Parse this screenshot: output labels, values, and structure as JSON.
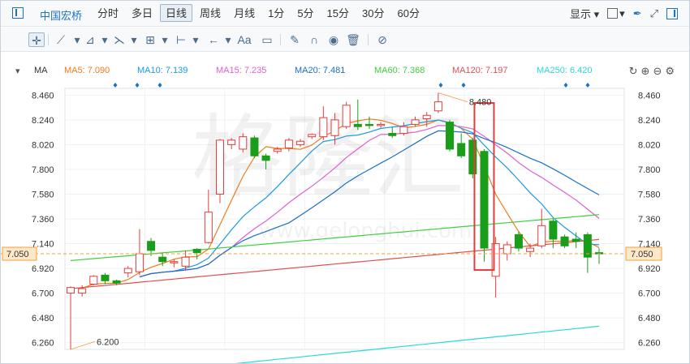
{
  "toolbar": {
    "ticker": "中国宏桥",
    "periods": [
      "分时",
      "多日",
      "日线",
      "周线",
      "月线",
      "1分",
      "5分",
      "15分",
      "30分",
      "60分"
    ],
    "active_period": "日线",
    "display_label": "显示"
  },
  "drawing_tools": [
    "crosshair",
    "line",
    "ray",
    "path",
    "fib",
    "horizontal",
    "arrow",
    "text",
    "note",
    "pen",
    "magnet",
    "eye",
    "trash",
    "link"
  ],
  "ma_bar": {
    "label": "MA",
    "items": [
      {
        "label": "MA5: 7.090",
        "color": "#f07c1c"
      },
      {
        "label": "MA10: 7.139",
        "color": "#1a9ae0"
      },
      {
        "label": "MA15: 7.235",
        "color": "#e05fd2"
      },
      {
        "label": "MA20: 7.481",
        "color": "#1a6fc8"
      },
      {
        "label": "MA60: 7.368",
        "color": "#3ecf3e"
      },
      {
        "label": "MA120: 7.197",
        "color": "#e05050"
      },
      {
        "label": "MA250: 6.420",
        "color": "#2ad8d8"
      }
    ]
  },
  "chart_data": {
    "type": "candlestick",
    "y_ticks": [
      "8.460",
      "8.240",
      "8.020",
      "7.800",
      "7.580",
      "7.360",
      "7.140",
      "6.920",
      "6.700",
      "6.480",
      "6.260"
    ],
    "ylim": [
      6.2,
      8.52
    ],
    "current_price": "7.050",
    "high_annotation": "8.480",
    "low_annotation": "6.200",
    "watermark": "格隆汇",
    "watermark_url": "www.gelonghui.com",
    "colors": {
      "up": "#e43c3c",
      "down": "#1a9e1a",
      "price_line": "#f0a040"
    },
    "candles": [
      {
        "o": 6.7,
        "c": 6.75,
        "h": 6.76,
        "l": 6.2
      },
      {
        "o": 6.7,
        "c": 6.74,
        "h": 6.77,
        "l": 6.67
      },
      {
        "o": 6.78,
        "c": 6.85,
        "h": 6.86,
        "l": 6.77
      },
      {
        "o": 6.86,
        "c": 6.81,
        "h": 6.88,
        "l": 6.78
      },
      {
        "o": 6.81,
        "c": 6.79,
        "h": 6.82,
        "l": 6.77
      },
      {
        "o": 6.88,
        "c": 6.92,
        "h": 6.94,
        "l": 6.84
      },
      {
        "o": 6.89,
        "c": 7.05,
        "h": 7.27,
        "l": 6.86
      },
      {
        "o": 7.16,
        "c": 7.08,
        "h": 7.19,
        "l": 7.03
      },
      {
        "o": 7.02,
        "c": 6.98,
        "h": 7.06,
        "l": 6.94
      },
      {
        "o": 6.98,
        "c": 6.98,
        "h": 7.0,
        "l": 6.93
      },
      {
        "o": 6.94,
        "c": 7.02,
        "h": 7.08,
        "l": 6.9
      },
      {
        "o": 7.09,
        "c": 7.06,
        "h": 7.1,
        "l": 7.0
      },
      {
        "o": 7.15,
        "c": 7.42,
        "h": 7.62,
        "l": 7.14
      },
      {
        "o": 7.58,
        "c": 8.06,
        "h": 8.07,
        "l": 7.5
      },
      {
        "o": 8.02,
        "c": 8.06,
        "h": 8.08,
        "l": 7.98
      },
      {
        "o": 7.98,
        "c": 8.09,
        "h": 8.12,
        "l": 7.95
      },
      {
        "o": 8.08,
        "c": 7.92,
        "h": 8.1,
        "l": 7.9
      },
      {
        "o": 7.92,
        "c": 7.88,
        "h": 7.94,
        "l": 7.8
      },
      {
        "o": 7.96,
        "c": 7.98,
        "h": 8.0,
        "l": 7.94
      },
      {
        "o": 7.99,
        "c": 8.06,
        "h": 8.08,
        "l": 7.96
      },
      {
        "o": 8.02,
        "c": 8.05,
        "h": 8.07,
        "l": 8.0
      },
      {
        "o": 8.09,
        "c": 8.11,
        "h": 8.12,
        "l": 8.07
      },
      {
        "o": 8.09,
        "c": 8.26,
        "h": 8.36,
        "l": 8.06
      },
      {
        "o": 8.1,
        "c": 8.24,
        "h": 8.3,
        "l": 8.02
      },
      {
        "o": 8.18,
        "c": 8.37,
        "h": 8.4,
        "l": 8.16
      },
      {
        "o": 8.2,
        "c": 8.18,
        "h": 8.42,
        "l": 8.15
      },
      {
        "o": 8.2,
        "c": 8.19,
        "h": 8.27,
        "l": 8.16
      },
      {
        "o": 8.2,
        "c": 8.2,
        "h": 8.22,
        "l": 8.17
      },
      {
        "o": 8.12,
        "c": 8.1,
        "h": 8.18,
        "l": 8.08
      },
      {
        "o": 8.12,
        "c": 8.18,
        "h": 8.22,
        "l": 8.1
      },
      {
        "o": 8.2,
        "c": 8.24,
        "h": 8.27,
        "l": 8.18
      },
      {
        "o": 8.25,
        "c": 8.28,
        "h": 8.31,
        "l": 8.18
      },
      {
        "o": 8.32,
        "c": 8.4,
        "h": 8.48,
        "l": 8.3
      },
      {
        "o": 8.22,
        "c": 7.98,
        "h": 8.24,
        "l": 7.96
      },
      {
        "o": 8.03,
        "c": 7.92,
        "h": 8.12,
        "l": 7.9
      },
      {
        "o": 8.06,
        "c": 7.76,
        "h": 8.08,
        "l": 7.72
      },
      {
        "o": 7.96,
        "c": 7.1,
        "h": 7.98,
        "l": 6.98
      },
      {
        "o": 6.85,
        "c": 7.14,
        "h": 7.2,
        "l": 6.66
      },
      {
        "o": 7.05,
        "c": 7.13,
        "h": 7.16,
        "l": 6.99
      },
      {
        "o": 7.22,
        "c": 7.1,
        "h": 7.25,
        "l": 7.07
      },
      {
        "o": 7.07,
        "c": 7.1,
        "h": 7.14,
        "l": 7.02
      },
      {
        "o": 7.12,
        "c": 7.3,
        "h": 7.45,
        "l": 7.1
      },
      {
        "o": 7.34,
        "c": 7.18,
        "h": 7.36,
        "l": 7.1
      },
      {
        "o": 7.2,
        "c": 7.12,
        "h": 7.22,
        "l": 7.1
      },
      {
        "o": 7.18,
        "c": 7.16,
        "h": 7.24,
        "l": 7.1
      },
      {
        "o": 7.22,
        "c": 7.02,
        "h": 7.24,
        "l": 6.88
      },
      {
        "o": 7.06,
        "c": 7.05,
        "h": 7.1,
        "l": 6.96
      }
    ]
  }
}
